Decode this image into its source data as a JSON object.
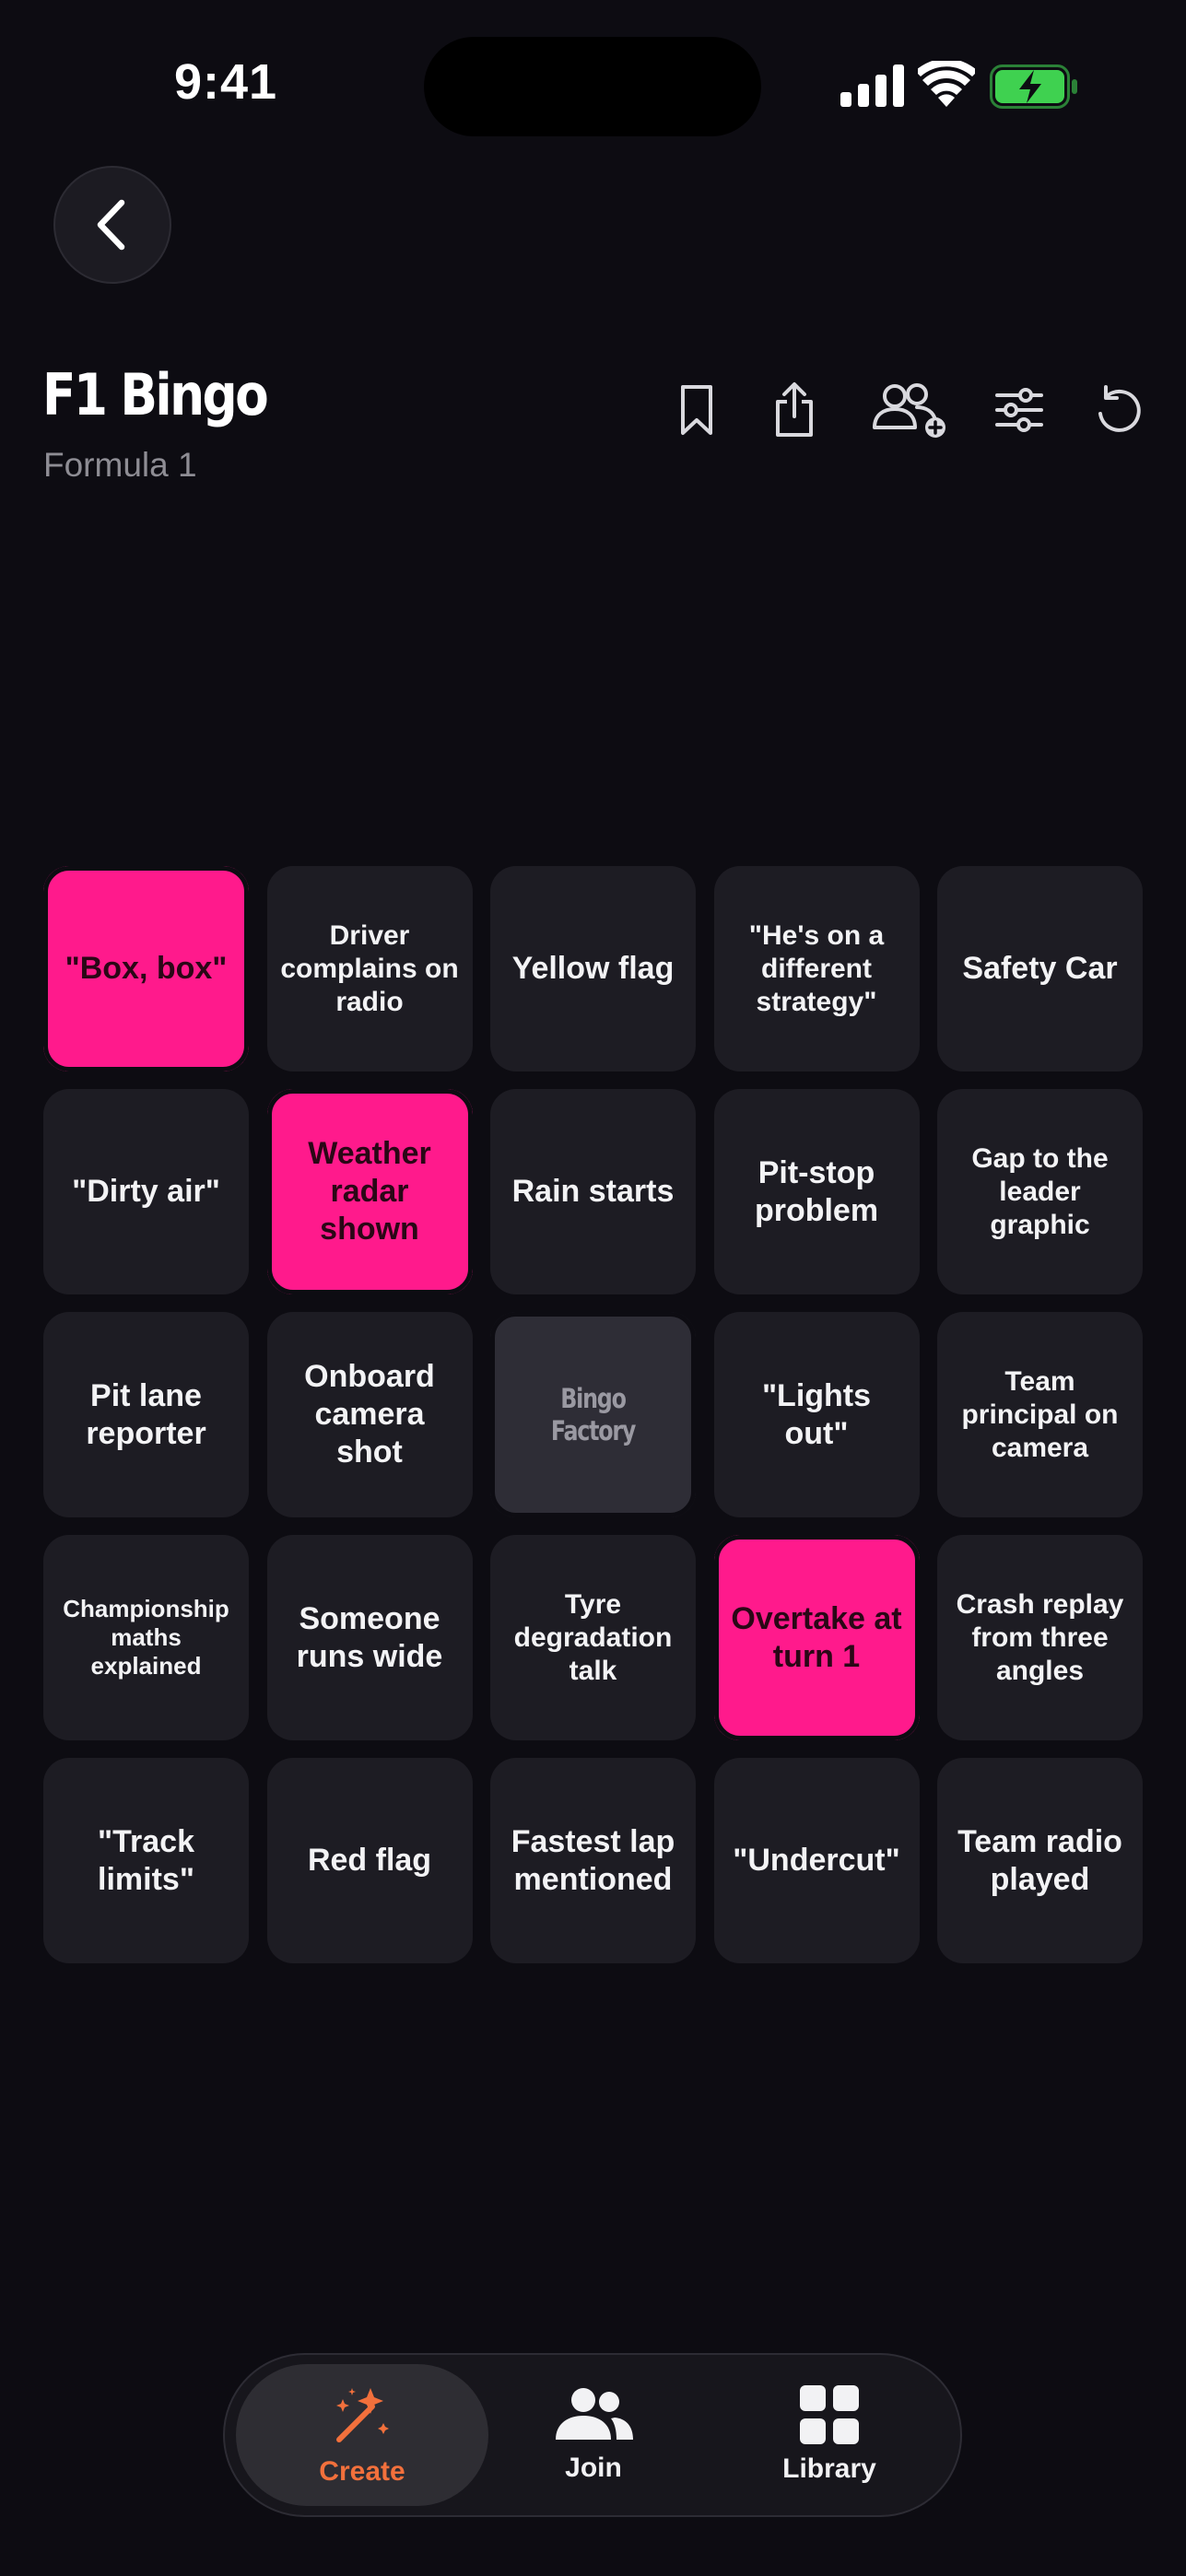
{
  "status_bar": {
    "time": "9:41"
  },
  "header": {
    "title": "F1 Bingo",
    "subtitle": "Formula 1"
  },
  "colors": {
    "background": "#0d0c12",
    "cell": "#1d1c23",
    "marked": "#ff1a8c",
    "free_cell": "#2e2d36",
    "accent": "#f2703c",
    "battery": "#3fd150"
  },
  "toolbar": {
    "icons": [
      "bookmark-icon",
      "share-icon",
      "add-people-icon",
      "sliders-icon",
      "refresh-icon"
    ]
  },
  "board": {
    "cells": [
      {
        "text": "\"Box, box\"",
        "marked": true,
        "free": false,
        "size": "l"
      },
      {
        "text": "Driver complains on radio",
        "marked": false,
        "free": false,
        "size": "m"
      },
      {
        "text": "Yellow flag",
        "marked": false,
        "free": false,
        "size": "l"
      },
      {
        "text": "\"He's on a different strategy\"",
        "marked": false,
        "free": false,
        "size": "m"
      },
      {
        "text": "Safety Car",
        "marked": false,
        "free": false,
        "size": "l"
      },
      {
        "text": "\"Dirty air\"",
        "marked": false,
        "free": false,
        "size": "l"
      },
      {
        "text": "Weather radar shown",
        "marked": true,
        "free": false,
        "size": "l"
      },
      {
        "text": "Rain starts",
        "marked": false,
        "free": false,
        "size": "l"
      },
      {
        "text": "Pit-stop problem",
        "marked": false,
        "free": false,
        "size": "l"
      },
      {
        "text": "Gap to the leader graphic",
        "marked": false,
        "free": false,
        "size": "m"
      },
      {
        "text": "Pit lane reporter",
        "marked": false,
        "free": false,
        "size": "l"
      },
      {
        "text": "Onboard camera shot",
        "marked": false,
        "free": false,
        "size": "l"
      },
      {
        "text": "Bingo Factory",
        "marked": false,
        "free": true,
        "size": "m"
      },
      {
        "text": "\"Lights out\"",
        "marked": false,
        "free": false,
        "size": "l"
      },
      {
        "text": "Team principal on camera",
        "marked": false,
        "free": false,
        "size": "m"
      },
      {
        "text": "Championship maths explained",
        "marked": false,
        "free": false,
        "size": "s"
      },
      {
        "text": "Someone runs wide",
        "marked": false,
        "free": false,
        "size": "l"
      },
      {
        "text": "Tyre degradation talk",
        "marked": false,
        "free": false,
        "size": "m"
      },
      {
        "text": "Overtake at turn 1",
        "marked": true,
        "free": false,
        "size": "l"
      },
      {
        "text": "Crash replay from three angles",
        "marked": false,
        "free": false,
        "size": "m"
      },
      {
        "text": "\"Track limits\"",
        "marked": false,
        "free": false,
        "size": "l"
      },
      {
        "text": "Red flag",
        "marked": false,
        "free": false,
        "size": "l"
      },
      {
        "text": "Fastest lap mentioned",
        "marked": false,
        "free": false,
        "size": "l"
      },
      {
        "text": "\"Undercut\"",
        "marked": false,
        "free": false,
        "size": "l"
      },
      {
        "text": "Team radio played",
        "marked": false,
        "free": false,
        "size": "l"
      }
    ]
  },
  "nav": {
    "create": {
      "label": "Create",
      "icon": "magic-wand-icon",
      "active": true
    },
    "join": {
      "label": "Join",
      "icon": "people-icon",
      "active": false
    },
    "library": {
      "label": "Library",
      "icon": "grid-icon",
      "active": false
    }
  }
}
